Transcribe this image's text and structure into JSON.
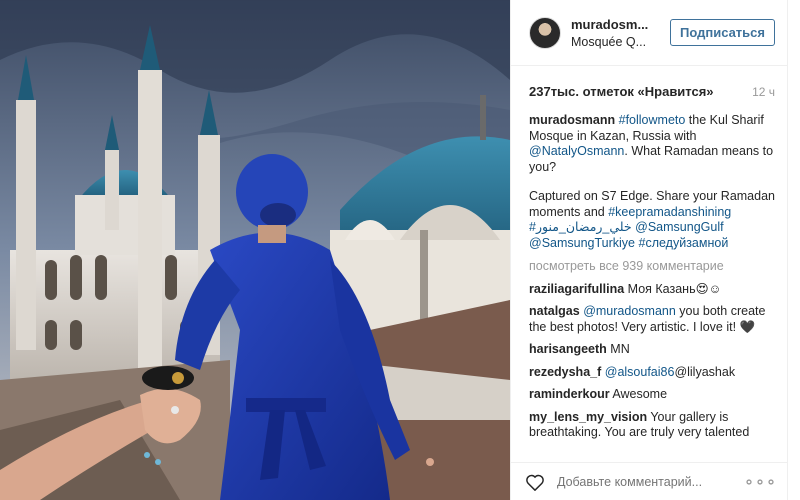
{
  "header": {
    "username": "muradosm...",
    "location": "Mosquée Q...",
    "follow_label": "Подписаться"
  },
  "likes": {
    "text": "237тыс. отметок «Нравится»",
    "time": "12 ч"
  },
  "caption": {
    "user": "muradosmann",
    "p1": [
      {
        "t": "#followmeto",
        "link": true
      },
      {
        "t": " the Kul Sharif Mosque in Kazan, Russia with ",
        "link": false
      },
      {
        "t": "@NatalyOsmann",
        "link": true
      },
      {
        "t": ". What Ramadan means to you?",
        "link": false
      }
    ],
    "p2": [
      {
        "t": "Captured on S7 Edge. Share your Ramadan moments and ",
        "link": false
      },
      {
        "t": "#keepramadanshining",
        "link": true
      },
      {
        "t": " ",
        "link": false
      },
      {
        "t": "#خلي_رمضان_منور",
        "link": true
      },
      {
        "t": " ",
        "link": false
      },
      {
        "t": "@SamsungGulf",
        "link": true
      },
      {
        "t": " ",
        "link": false
      },
      {
        "t": "@SamsungTurkiye",
        "link": true
      },
      {
        "t": " ",
        "link": false
      },
      {
        "t": "#следуйзамной",
        "link": true
      }
    ]
  },
  "view_all": "посмотреть все 939 комментарие",
  "comments": [
    {
      "user": "raziliagarifullina",
      "parts": [
        {
          "t": " Моя Казань😍☺",
          "link": false
        }
      ]
    },
    {
      "user": "natalgas",
      "parts": [
        {
          "t": " ",
          "link": false
        },
        {
          "t": "@muradosmann",
          "link": true
        },
        {
          "t": " you both create the best photos! Very artistic. I love it! 🖤",
          "link": false
        }
      ]
    },
    {
      "user": "harisangeeth",
      "parts": [
        {
          "t": " MN",
          "link": false
        }
      ]
    },
    {
      "user": "rezedysha_f",
      "parts": [
        {
          "t": " ",
          "link": false
        },
        {
          "t": "@alsoufai86",
          "link": true
        },
        {
          "t": "@lilyashak",
          "link": false
        }
      ]
    },
    {
      "user": "raminderkour",
      "parts": [
        {
          "t": " Awesome",
          "link": false
        }
      ]
    },
    {
      "user": "my_lens_my_vision",
      "parts": [
        {
          "t": " Your gallery is breathtaking. You are truly very talented",
          "link": false
        }
      ]
    }
  ],
  "footer": {
    "placeholder": "Добавьте комментарий...",
    "more_label": "∘∘∘"
  },
  "icons": {
    "heart": "heart-icon",
    "more": "more-options-icon"
  },
  "colors": {
    "link": "#125688",
    "follow": "#3f729b",
    "muted": "#999999",
    "dress": "#1e3aa8"
  }
}
